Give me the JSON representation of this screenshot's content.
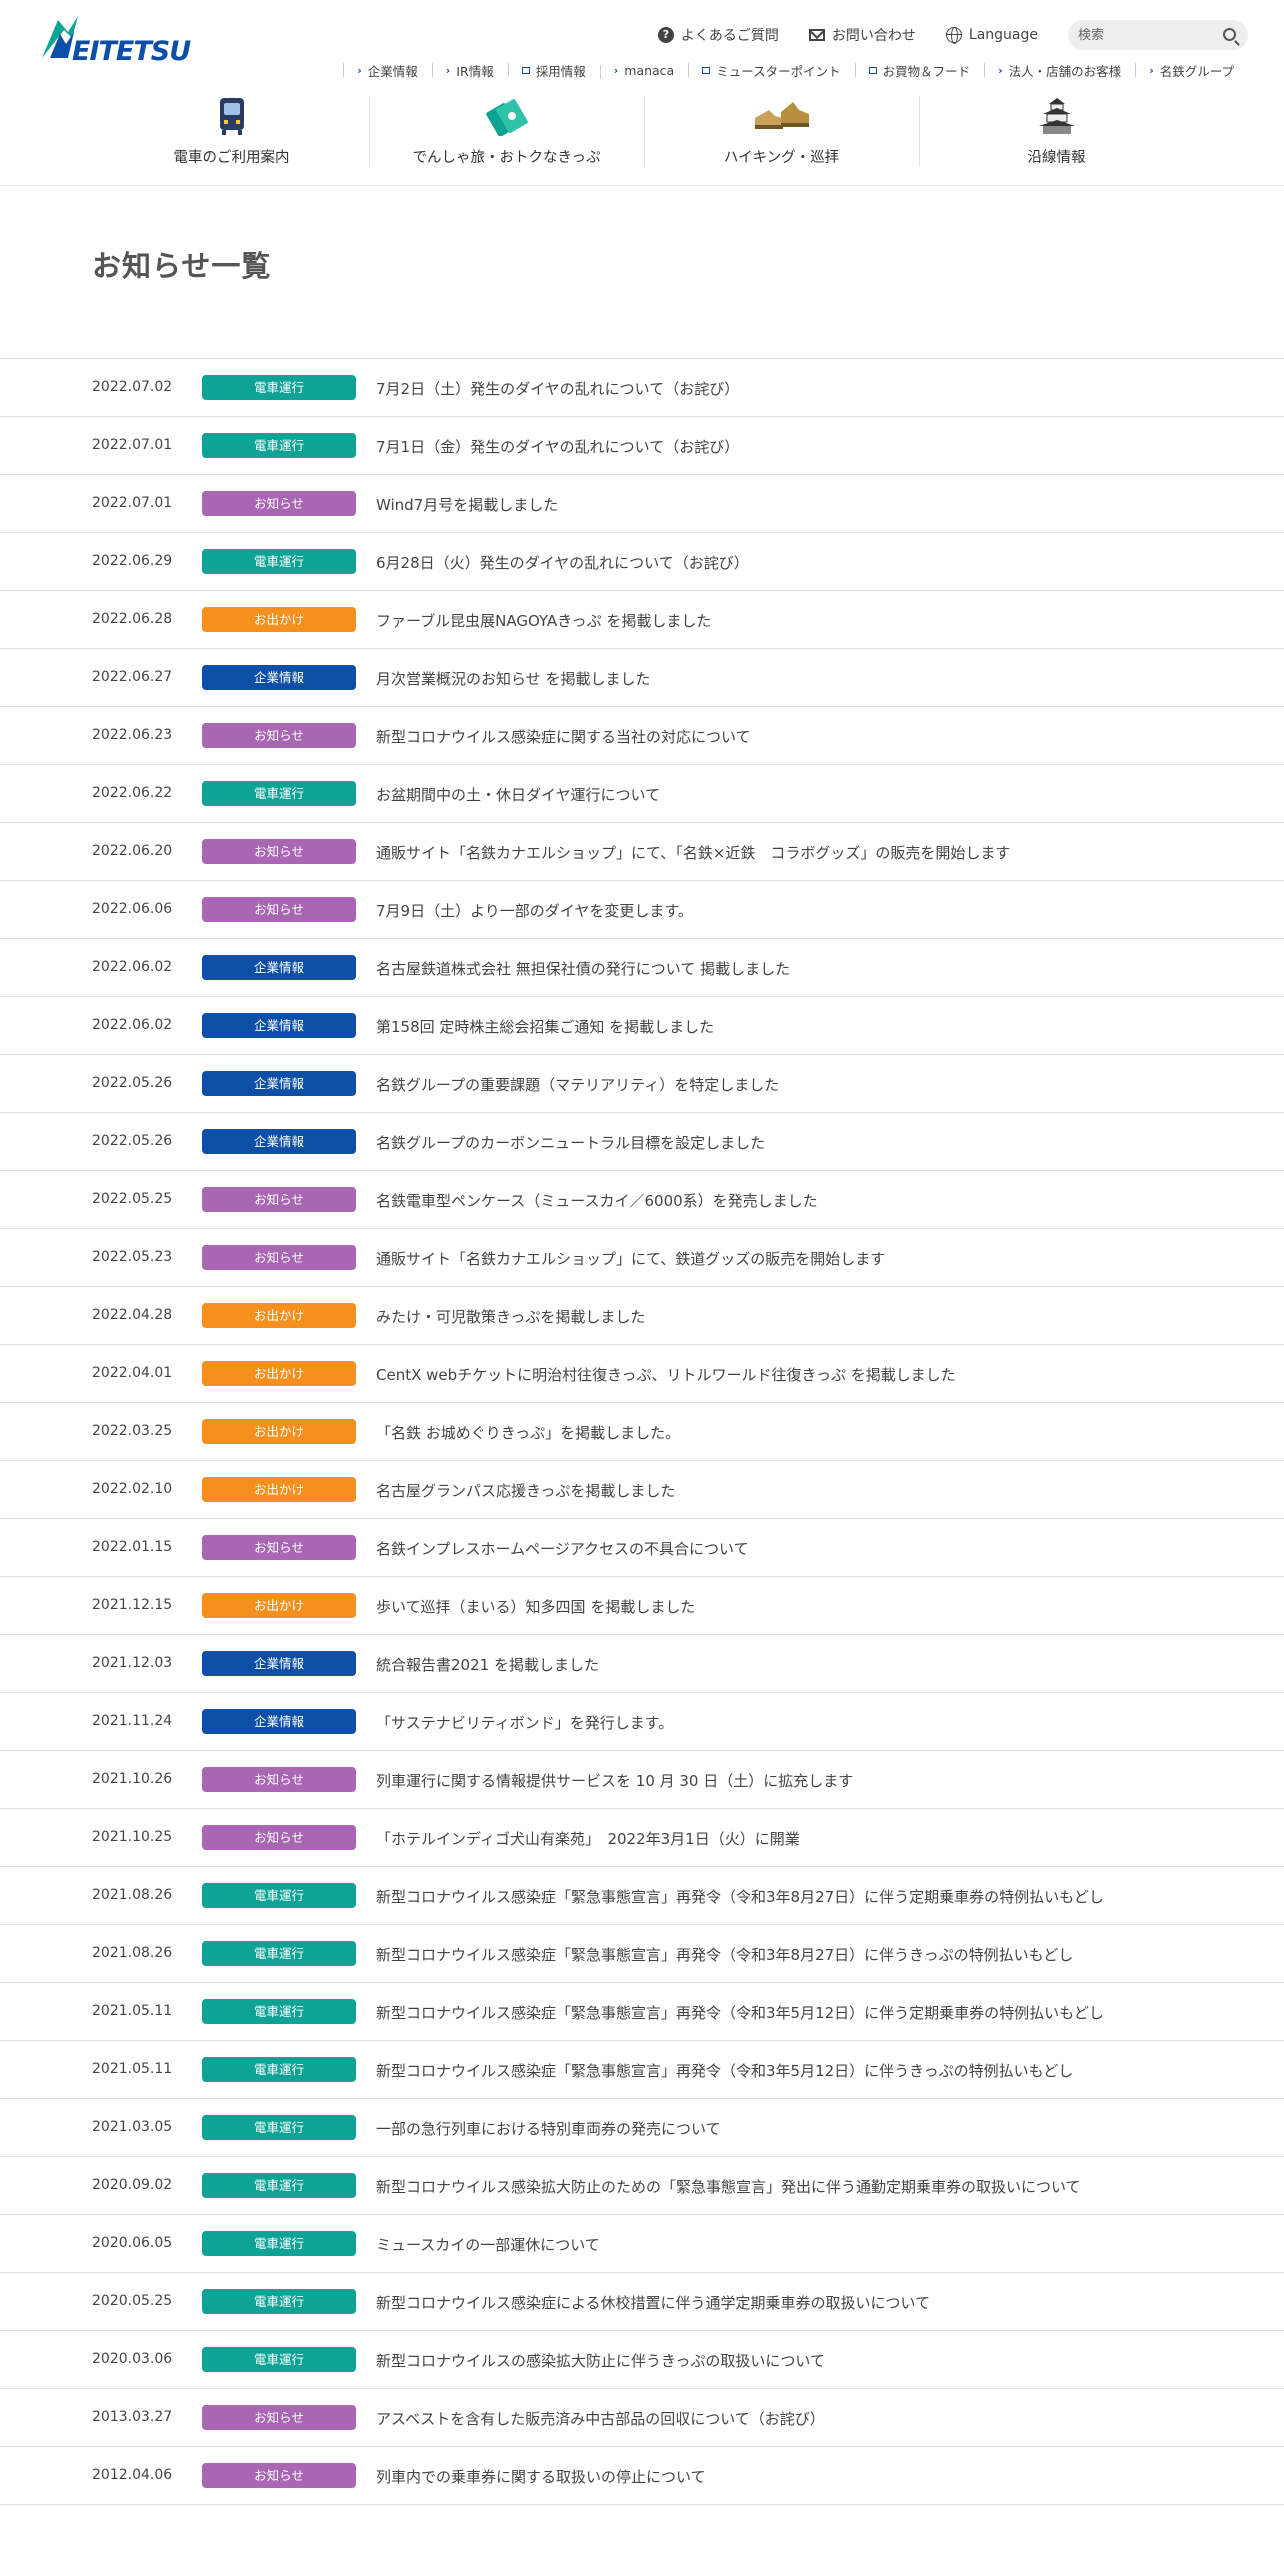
{
  "header": {
    "logo_text": "MEITETSU",
    "util": {
      "faq": "よくあるご質問",
      "contact": "お問い合わせ",
      "language": "Language",
      "search_placeholder": "検索"
    },
    "sublinks": [
      {
        "label": "企業情報",
        "icon": "chevron-right-icon"
      },
      {
        "label": "IR情報",
        "icon": "chevron-right-icon"
      },
      {
        "label": "採用情報",
        "icon": "external-link-icon"
      },
      {
        "label": "manaca",
        "icon": "chevron-right-icon"
      },
      {
        "label": "ミュースターポイント",
        "icon": "external-link-icon"
      },
      {
        "label": "お買物＆フード",
        "icon": "external-link-icon"
      },
      {
        "label": "法人・店舗のお客様",
        "icon": "chevron-right-icon"
      },
      {
        "label": "名鉄グループ",
        "icon": "chevron-right-icon"
      }
    ],
    "mainnav": [
      {
        "label": "電車のご利用案内",
        "icon": "train-icon"
      },
      {
        "label": "でんしゃ旅・おトクなきっぷ",
        "icon": "ticket-icon"
      },
      {
        "label": "ハイキング・巡拝",
        "icon": "hiking-boots-icon"
      },
      {
        "label": "沿線情報",
        "icon": "castle-icon"
      }
    ]
  },
  "page_title": "お知らせ一覧",
  "categories": {
    "train": {
      "label": "電車運行",
      "color": "#0fa396"
    },
    "notice": {
      "label": "お知らせ",
      "color": "#a866b3"
    },
    "outing": {
      "label": "お出かけ",
      "color": "#f5901f"
    },
    "corporate": {
      "label": "企業情報",
      "color": "#0d4ea6"
    }
  },
  "news": [
    {
      "date": "2022.07.02",
      "cat": "train",
      "title": "7月2日（土）発生のダイヤの乱れについて（お詫び）"
    },
    {
      "date": "2022.07.01",
      "cat": "train",
      "title": "7月1日（金）発生のダイヤの乱れについて（お詫び）"
    },
    {
      "date": "2022.07.01",
      "cat": "notice",
      "title": "Wind7月号を掲載しました"
    },
    {
      "date": "2022.06.29",
      "cat": "train",
      "title": "6月28日（火）発生のダイヤの乱れについて（お詫び）"
    },
    {
      "date": "2022.06.28",
      "cat": "outing",
      "title": "ファーブル昆虫展NAGOYAきっぷ を掲載しました"
    },
    {
      "date": "2022.06.27",
      "cat": "corporate",
      "title": "月次営業概況のお知らせ を掲載しました"
    },
    {
      "date": "2022.06.23",
      "cat": "notice",
      "title": "新型コロナウイルス感染症に関する当社の対応について"
    },
    {
      "date": "2022.06.22",
      "cat": "train",
      "title": "お盆期間中の土・休日ダイヤ運行について"
    },
    {
      "date": "2022.06.20",
      "cat": "notice",
      "title": "通販サイト「名鉄カナエルショップ」にて、「名鉄×近鉄　コラボグッズ」の販売を開始します"
    },
    {
      "date": "2022.06.06",
      "cat": "notice",
      "title": "7月9日（土）より一部のダイヤを変更します。"
    },
    {
      "date": "2022.06.02",
      "cat": "corporate",
      "title": "名古屋鉄道株式会社 無担保社債の発行について 掲載しました"
    },
    {
      "date": "2022.06.02",
      "cat": "corporate",
      "title": "第158回 定時株主総会招集ご通知 を掲載しました"
    },
    {
      "date": "2022.05.26",
      "cat": "corporate",
      "title": "名鉄グループの重要課題（マテリアリティ）を特定しました"
    },
    {
      "date": "2022.05.26",
      "cat": "corporate",
      "title": "名鉄グループのカーボンニュートラル目標を設定しました"
    },
    {
      "date": "2022.05.25",
      "cat": "notice",
      "title": "名鉄電車型ペンケース（ミュースカイ／6000系）を発売しました"
    },
    {
      "date": "2022.05.23",
      "cat": "notice",
      "title": "通販サイト「名鉄カナエルショップ」にて、鉄道グッズの販売を開始します"
    },
    {
      "date": "2022.04.28",
      "cat": "outing",
      "title": "みたけ・可児散策きっぷを掲載しました"
    },
    {
      "date": "2022.04.01",
      "cat": "outing",
      "title": "CentX webチケットに明治村往復きっぷ、リトルワールド往復きっぷ を掲載しました"
    },
    {
      "date": "2022.03.25",
      "cat": "outing",
      "title": "「名鉄 お城めぐりきっぷ」を掲載しました。"
    },
    {
      "date": "2022.02.10",
      "cat": "outing",
      "title": "名古屋グランパス応援きっぷを掲載しました"
    },
    {
      "date": "2022.01.15",
      "cat": "notice",
      "title": "名鉄インプレスホームページアクセスの不具合について"
    },
    {
      "date": "2021.12.15",
      "cat": "outing",
      "title": "歩いて巡拝（まいる）知多四国 を掲載しました"
    },
    {
      "date": "2021.12.03",
      "cat": "corporate",
      "title": "統合報告書2021 を掲載しました"
    },
    {
      "date": "2021.11.24",
      "cat": "corporate",
      "title": "「サステナビリティボンド」を発行します。"
    },
    {
      "date": "2021.10.26",
      "cat": "notice",
      "title": "列車運行に関する情報提供サービスを 10 月 30 日（土）に拡充します"
    },
    {
      "date": "2021.10.25",
      "cat": "notice",
      "title": "「ホテルインディゴ犬山有楽苑」　2022年3月1日（火）に開業"
    },
    {
      "date": "2021.08.26",
      "cat": "train",
      "title": "新型コロナウイルス感染症「緊急事態宣言」再発令（令和3年8月27日）に伴う定期乗車券の特例払いもどし"
    },
    {
      "date": "2021.08.26",
      "cat": "train",
      "title": "新型コロナウイルス感染症「緊急事態宣言」再発令（令和3年8月27日）に伴うきっぷの特例払いもどし"
    },
    {
      "date": "2021.05.11",
      "cat": "train",
      "title": "新型コロナウイルス感染症「緊急事態宣言」再発令（令和3年5月12日）に伴う定期乗車券の特例払いもどし"
    },
    {
      "date": "2021.05.11",
      "cat": "train",
      "title": "新型コロナウイルス感染症「緊急事態宣言」再発令（令和3年5月12日）に伴うきっぷの特例払いもどし"
    },
    {
      "date": "2021.03.05",
      "cat": "train",
      "title": "一部の急行列車における特別車両券の発売について"
    },
    {
      "date": "2020.09.02",
      "cat": "train",
      "title": "新型コロナウイルス感染拡大防止のための「緊急事態宣言」発出に伴う通勤定期乗車券の取扱いについて"
    },
    {
      "date": "2020.06.05",
      "cat": "train",
      "title": "ミュースカイの一部運休について"
    },
    {
      "date": "2020.05.25",
      "cat": "train",
      "title": "新型コロナウイルス感染症による休校措置に伴う通学定期乗車券の取扱いについて"
    },
    {
      "date": "2020.03.06",
      "cat": "train",
      "title": "新型コロナウイルスの感染拡大防止に伴うきっぷの取扱いについて"
    },
    {
      "date": "2013.03.27",
      "cat": "notice",
      "title": "アスベストを含有した販売済み中古部品の回収について（お詫び）"
    },
    {
      "date": "2012.04.06",
      "cat": "notice",
      "title": "列車内での乗車券に関する取扱いの停止について"
    }
  ]
}
